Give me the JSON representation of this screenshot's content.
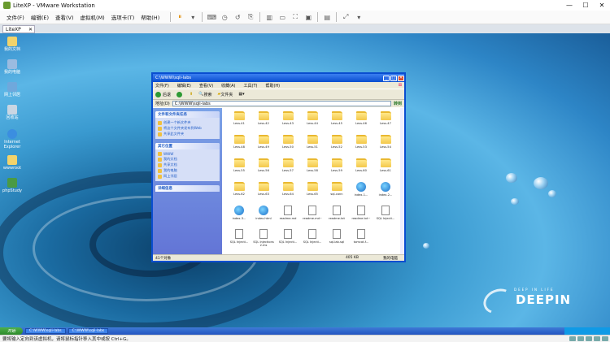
{
  "window": {
    "title": "LiteXP - VMware Workstation",
    "controls": [
      "—",
      "☐",
      "✕"
    ]
  },
  "menu": [
    "文件(F)",
    "编辑(E)",
    "查看(V)",
    "虚拟机(M)",
    "选项卡(T)",
    "帮助(H)"
  ],
  "tab": {
    "label": "LiteXP"
  },
  "desktop_icons": [
    "我的文档",
    "我的电脑",
    "网上邻居",
    "回收站",
    "Internet Explorer",
    "wwwroot",
    "phpStudy"
  ],
  "explorer": {
    "title": "C:\\WWW\\sqli-labs",
    "menu": [
      "文件(F)",
      "编辑(E)",
      "查看(V)",
      "收藏(A)",
      "工具(T)",
      "帮助(H)"
    ],
    "toolbar": {
      "back": "后退",
      "search": "搜索",
      "folders": "文件夹"
    },
    "address_label": "地址(D)",
    "address": "C:\\WWW\\sqli-labs",
    "go": "转到",
    "tasks_title": "文件和文件夹任务",
    "tasks": [
      "创建一个新文件夹",
      "将这个文件夹发布到Web",
      "共享此文件夹"
    ],
    "places_title": "其它位置",
    "places": [
      "WWW",
      "我的文档",
      "共享文档",
      "我的电脑",
      "网上邻居"
    ],
    "details_title": "详细信息",
    "files": [
      {
        "name": "Less-41",
        "type": "folder"
      },
      {
        "name": "Less-42",
        "type": "folder"
      },
      {
        "name": "Less-43",
        "type": "folder"
      },
      {
        "name": "Less-44",
        "type": "folder"
      },
      {
        "name": "Less-45",
        "type": "folder"
      },
      {
        "name": "Less-46",
        "type": "folder"
      },
      {
        "name": "Less-47",
        "type": "folder"
      },
      {
        "name": "Less-48",
        "type": "folder"
      },
      {
        "name": "Less-49",
        "type": "folder"
      },
      {
        "name": "Less-50",
        "type": "folder"
      },
      {
        "name": "Less-51",
        "type": "folder"
      },
      {
        "name": "Less-52",
        "type": "folder"
      },
      {
        "name": "Less-53",
        "type": "folder"
      },
      {
        "name": "Less-54",
        "type": "folder"
      },
      {
        "name": "Less-55",
        "type": "folder"
      },
      {
        "name": "Less-56",
        "type": "folder"
      },
      {
        "name": "Less-57",
        "type": "folder"
      },
      {
        "name": "Less-58",
        "type": "folder"
      },
      {
        "name": "Less-59",
        "type": "folder"
      },
      {
        "name": "Less-60",
        "type": "folder"
      },
      {
        "name": "Less-61",
        "type": "folder"
      },
      {
        "name": "Less-62",
        "type": "folder"
      },
      {
        "name": "Less-63",
        "type": "folder"
      },
      {
        "name": "Less-64",
        "type": "folder"
      },
      {
        "name": "Less-65",
        "type": "folder"
      },
      {
        "name": "sql-conn",
        "type": "folder"
      },
      {
        "name": "index-1...",
        "type": "ie"
      },
      {
        "name": "index-2...",
        "type": "ie"
      },
      {
        "name": "index-3...",
        "type": "ie"
      },
      {
        "name": "index.html",
        "type": "ie"
      },
      {
        "name": "readme.md",
        "type": "doc"
      },
      {
        "name": "readme.md~",
        "type": "doc"
      },
      {
        "name": "readme.txt",
        "type": "doc"
      },
      {
        "name": "readme.txt~",
        "type": "doc"
      },
      {
        "name": "SQL Injecti...",
        "type": "doc"
      },
      {
        "name": "SQL Injecti...",
        "type": "doc"
      },
      {
        "name": "SQL Injections 2.ms",
        "type": "doc"
      },
      {
        "name": "SQL Injecti...",
        "type": "doc"
      },
      {
        "name": "SQL Injecti...",
        "type": "doc"
      },
      {
        "name": "sql-lab.sql",
        "type": "doc"
      },
      {
        "name": "tomcat-f...",
        "type": "doc"
      }
    ],
    "status_left": "41个对象",
    "status_mid": "405 KB",
    "status_right": "我的电脑"
  },
  "taskbar": {
    "start": "开始",
    "tasks": [
      "C:\\WWW\\sqli-labs",
      "C:\\WWW\\sqli-labs"
    ],
    "time": ""
  },
  "brand": {
    "tagline": "DEEP IN LIFE",
    "wordmark": "DEEPIN"
  },
  "statusbar": {
    "text": "要将输入定向到该虚拟机，请将鼠标指针移入其中或按 Ctrl+G。"
  }
}
